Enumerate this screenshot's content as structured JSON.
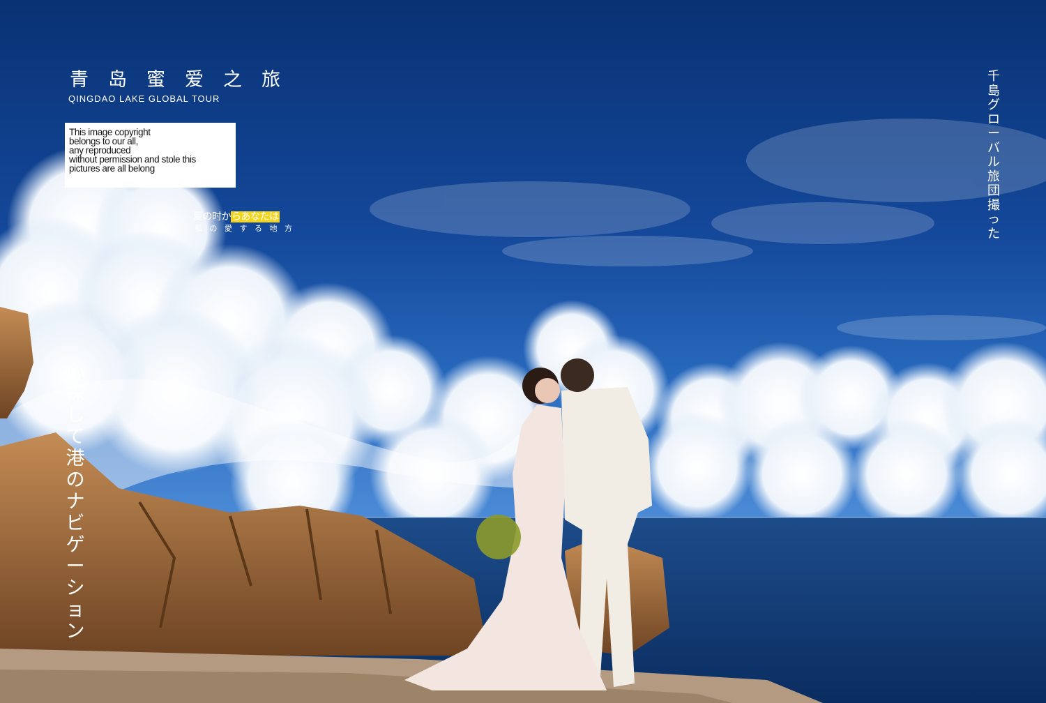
{
  "title": {
    "chinese": "青岛蜜爱之旅",
    "english": "QINGDAO LAKE GLOBAL TOUR"
  },
  "copyright": [
    "This image copyright",
    "belongs to our all,",
    "any reproduced",
    "without permission and stole this",
    "pictures are all belong"
  ],
  "tagline": {
    "line1_plain": "夏の时か",
    "line1_highlight": "らあなたは",
    "line2": "私の愛する地方"
  },
  "vertical_right": "千島グローバル旅団撮った",
  "vertical_left": "心探して港のナビゲーション",
  "colors": {
    "sky_top": "#0a357a",
    "sky_mid": "#1e5fae",
    "sea": "#0f3f7c",
    "rock": "#a86f3e",
    "highlight": "#f3d51d"
  }
}
